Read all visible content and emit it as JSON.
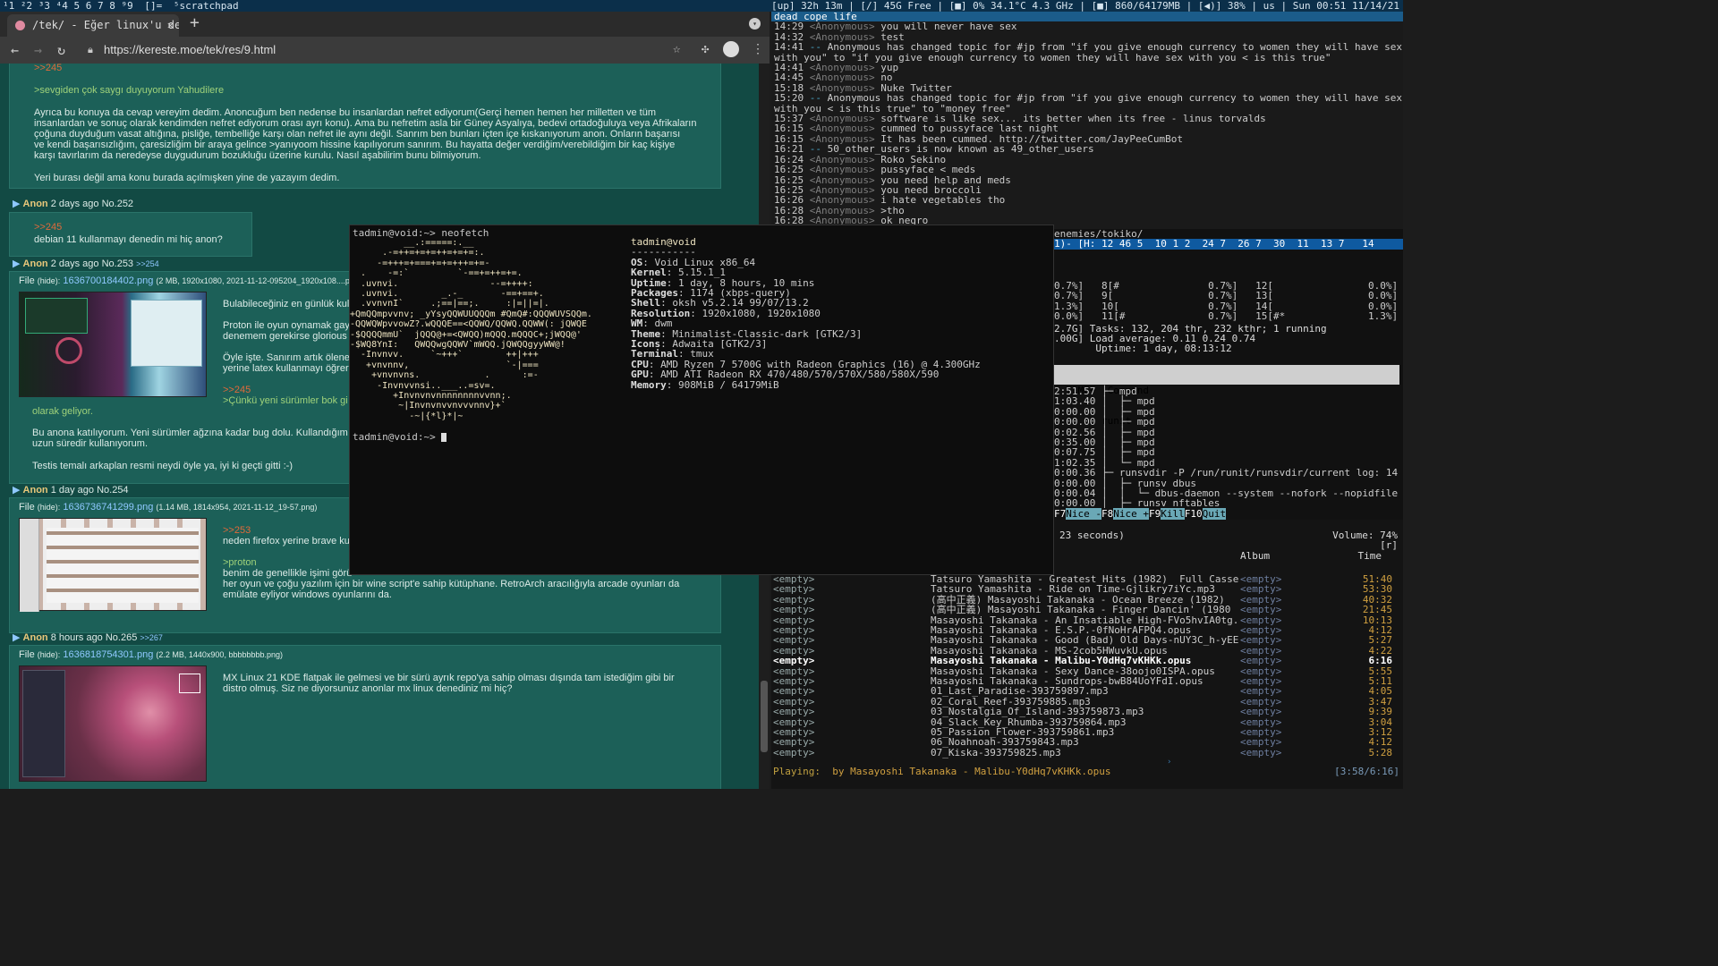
{
  "topbar": {
    "workspaces": "¹1 ²2 ³3 ⁴4 5 6 7 8 ⁹9",
    "layout": "[]=",
    "title": "⁵scratchpad",
    "status": "[up] 32h 13m | [/] 45G Free | [■] 0% 34.1°C 4.3 GHz | [■] 860/64179MB | [◀)] 38% | us | Sun 00:51 11/14/21"
  },
  "browser": {
    "tab_title": "/tek/ - Eğer linux'u denemek",
    "new_tab": "+",
    "url": "https://kereste.moe/tek/res/9.html"
  },
  "posts": {
    "p0": {
      "reply": ">>245",
      "quote": ">sevgiden çok saygı duyuyorum Yahudilere",
      "body1": "Ayrıca bu konuya da cevap vereyim dedim. Anoncuğum ben nedense bu insanlardan nefret ediyorum(Gerçi hemen hemen her milletten ve tüm",
      "body2": "insanlardan ve sonuç olarak kendimden nefret ediyorum orası ayrı konu). Ama bu nefretim asla bir Güney Asyalıya, bedevi ortadoğuluya veya Afrikaların",
      "body3": "çoğuna duyduğum vasat altığına, pisliğe, tembelliğe karşı olan nefret ile aynı değil. Sanrım ben bunları içten içe kıskanıyorum anon. Onların başarısı",
      "body4": "ve kendi başarısızlığım, çaresizliğim bir araya gelince >yanıyoom hissine kapılıyorum sanırım. Bu hayatta değer verdiğim/verebildiğim bir kaç kişiye",
      "body5": "karşı tavırlarım da neredeyse duygudurum bozukluğu üzerine kurulu. Nasıl aşabilirim bunu bilmiyorum.",
      "body6": "Yeri burası değil ama konu burada açılmışken yine de yazayım dedim."
    },
    "p252": {
      "name": "Anon",
      "meta": "2 days ago No.252",
      "reply": ">>245",
      "body": "debian 11 kullanmayı denedin mi hiç anon?"
    },
    "p253": {
      "name": "Anon",
      "meta": "2 days ago No.253",
      "backlink": ">>254",
      "file_label": "File",
      "hide": "(hide):",
      "file": "1636700184402.png",
      "file_meta": "(2 MB, 1920x1080, 2021-11-12-095204_1920x108....png)",
      "l1": "Bulabileceğiniz en günlük kul",
      "l2": "Proton ile oyun oynamak gay",
      "l3": "denemem gerekirse glorious",
      "l4": "Öyle işte. Sanırım artık ölene",
      "l5": "yerine latex kullanmayı öğrer",
      "reply": ">>245",
      "quote": ">Çünkü yeni sürümler bok gi",
      "l6": "olarak geliyor.",
      "l7": "Bu anona katılıyorum. Yeni sürümler ağzına kadar bug dolu. Kullandığım",
      "l8": "uzun süredir kullanıyorum.",
      "l9": "Testis temalı arkaplan resmi neydi öyle ya, iyi ki geçti gitti :-)"
    },
    "p254": {
      "name": "Anon",
      "meta": "1 day ago No.254",
      "file_label": "File",
      "hide": "(hide):",
      "file": "1636736741299.png",
      "file_meta": "(1.14 MB, 1814x954, 2021-11-12_19-57.png)",
      "reply": ">>253",
      "l1": "neden firefox yerine brave ku",
      "quote": ">proton",
      "l2": "benim de genellikle işimi görü",
      "l3": "her oyun ve çoğu yazılım için bir wine script'e sahip kütüphane. RetroArch aracılığıyla arcade oyunları da",
      "l4": "emülate eyliyor windows oyunlarını da."
    },
    "p265": {
      "name": "Anon",
      "meta": "8 hours ago No.265",
      "backlink": ">>267",
      "file_label": "File",
      "hide": "(hide):",
      "file": "1636818754301.png",
      "file_meta": "(2.2 MB, 1440x900, bbbbbbbb.png)",
      "l1": "MX Linux 21 KDE flatpak ile gelmesi ve bir sürü ayrık repo'ya sahip olması dışında tam istediğim gibi bir",
      "l2": "distro olmuş. Siz ne diyorsunuz anonlar mx linux denediniz mi hiç?"
    }
  },
  "terminal": {
    "prompt1": "tadmin@void:~> neofetch",
    "prompt2": "tadmin@void:~> ",
    "host": "tadmin@void",
    "sep": "-----------",
    "info": [
      [
        "OS",
        ": Void Linux x86_64"
      ],
      [
        "Kernel",
        ": 5.15.1_1"
      ],
      [
        "Uptime",
        ": 1 day, 8 hours, 10 mins"
      ],
      [
        "Packages",
        ": 1174 (xbps-query)"
      ],
      [
        "Shell",
        ": oksh v5.2.14 99/07/13.2"
      ],
      [
        "Resolution",
        ": 1920x1080, 1920x1080"
      ],
      [
        "WM",
        ": dwm"
      ],
      [
        "Theme",
        ": Minimalist-Classic-dark [GTK2/3]"
      ],
      [
        "Icons",
        ": Adwaita [GTK2/3]"
      ],
      [
        "Terminal",
        ": tmux"
      ],
      [
        "CPU",
        ": AMD Ryzen 7 5700G with Radeon Graphics (16) @ 4.300GHz"
      ],
      [
        "GPU",
        ": AMD ATI Radeon RX 470/480/570/570X/580/580X/590"
      ],
      [
        "Memory",
        ": 908MiB / 64179MiB"
      ]
    ],
    "art": [
      "          __.:=====:.__",
      "      .-=++=+=+=++=+=+=:.",
      "     -=+++=+===+=+=+++=+=-",
      "  .    -=:`         `-==+=++=+=.",
      "  .uvnvi.                 --=++++:",
      "  .uvnvi.        _.-_       -==+==+.",
      "  .vvnvnI`     .;==|==;.     :|=||=|.",
      "+QmQQmpvvnv; _yYsyQQWUUQQQm #QmQ#:QQQWUVSQQm.",
      "-QQWQWpvvowZ?.wQQQE==<QQWQ/QQWQ.QQWW(: jQWQE",
      "-$QQQQmmU`  jQQQ@+=<QWQQ)mQQQ.mQQQC+;jWQQ@'",
      "-$WQ8YnI:   QWQQwgQQWV`mWQQ.jQWQQgyyWW@!",
      "  -Invnvv.     `~+++`        ++|+++",
      "   +vnvnnv,                  `-|===",
      "    +vnvnvns.            .      :=-",
      "     -Invnvvnsi..___..=sv=.",
      "        +Invnvnvnnnnnnnnvvnn;.",
      "         ~|Invnvnvvnvvvnnv}+`",
      "           -~|{*l}*|~"
    ]
  },
  "irc": {
    "topic": "dead cope life",
    "lines": [
      [
        "14:29",
        "<Anonymous>",
        "you will never have sex"
      ],
      [
        "14:32",
        "<Anonymous>",
        "test"
      ],
      [
        "14:41",
        "--",
        "Anonymous has changed topic for #jp from \"if you give enough currency to women they will have sex"
      ],
      [
        "",
        "",
        "with you\" to \"if you give enough currency to women they will have sex with you < is this true\""
      ],
      [
        "14:41",
        "<Anonymous>",
        "yup"
      ],
      [
        "14:45",
        "<Anonymous>",
        "no"
      ],
      [
        "15:18",
        "<Anonymous>",
        "Nuke Twitter"
      ],
      [
        "15:20",
        "--",
        "Anonymous has changed topic for #jp from \"if you give enough currency to women they will have sex"
      ],
      [
        "",
        "",
        "with you < is this true\" to \"money free\""
      ],
      [
        "15:37",
        "<Anonymous>",
        "software is like sex... its better when its free - linus torvalds"
      ],
      [
        "16:15",
        "<Anonymous>",
        "cummed to pussyface last night"
      ],
      [
        "16:15",
        "<Anonymous>",
        "It has been cummed. http://twitter.com/JayPeeCumBot"
      ],
      [
        "16:21",
        "--",
        "50_other_users is now known as 49_other_users"
      ],
      [
        "16:24",
        "<Anonymous>",
        "Roko Sekino"
      ],
      [
        "16:25",
        "<Anonymous>",
        "pussyface < meds"
      ],
      [
        "16:25",
        "<Anonymous>",
        "you need help and meds"
      ],
      [
        "16:25",
        "<Anonymous>",
        "you need broccoli"
      ],
      [
        "16:26",
        "<Anonymous>",
        "i hate vegetables tho"
      ],
      [
        "16:28",
        "<Anonymous>",
        ">tho"
      ],
      [
        "16:28",
        "<Anonymous>",
        "ok negro"
      ]
    ],
    "path": "enemies/tokiko/"
  },
  "htop": {
    "cpu_bar": "1)- [H: 12 46 5  10 1 2  24 7  26 7  30  11  13 7   14",
    "rows": [
      "0.7%]   8[#               0.7%]   12[                0.0%]",
      "0.7%]   9[                0.7%]   13[                0.0%]",
      "1.3%]   10[               0.7%]   14[                0.0%]",
      "0.0%]   11[#              0.7%]   15[#*              1.3%]"
    ],
    "tasks": "2.7G] Tasks: 132, 204 thr, 232 kthr; 1 running",
    "load": ".00G] Load average: 0.11 0.24 0.74",
    "uptime": "       Uptime: 1 day, 08:13:12",
    "cols": "  TIME+  Command",
    "sel": "0:00.40 runit",
    "procs": [
      "2:51.57 ├─ mpd",
      "1:03.40 │  ├─ mpd",
      "0:00.00 │  ├─ mpd",
      "0:00.00 │  ├─ mpd",
      "0:02.56 │  ├─ mpd",
      "0:35.00 │  ├─ mpd",
      "0:07.75 │  ├─ mpd",
      "1:02.35 │  └─ mpd",
      "0:00.36 ├─ runsvdir -P /run/runit/runsvdir/current log: 14",
      "0:00.00 │  ├─ runsv dbus",
      "0:00.04 │  │  └─ dbus-daemon --system --nofork --nopidfile",
      "0:00.00 │  ├─ runsv nftables"
    ],
    "fkeys": [
      [
        "F7",
        "Nice -"
      ],
      [
        "F8",
        "Nice +"
      ],
      [
        "F9",
        "Kill"
      ],
      [
        "F10",
        "Quit"
      ]
    ]
  },
  "mpd": {
    "status": "23 seconds)",
    "volume": "Volume: 74%",
    "flags": "[r]",
    "col_album": "Album",
    "col_time": "Time",
    "rows": [
      [
        "<empty>",
        "Tatsuro Yamashita - Greatest Hits (1982)  Full Casse",
        "<empty>",
        "51:40"
      ],
      [
        "<empty>",
        "Tatsuro Yamashita - Ride on Time-Gjlikry7iYc.mp3",
        "<empty>",
        "53:30"
      ],
      [
        "<empty>",
        "(高中正義) Masayoshi Takanaka - Ocean Breeze (1982)",
        "<empty>",
        "40:32"
      ],
      [
        "<empty>",
        "(高中正義) Masayoshi Takanaka - Finger Dancin' (1980",
        "<empty>",
        "21:45"
      ],
      [
        "<empty>",
        "Masayoshi Takanaka - An Insatiable High-FVo5hvIA0tg.",
        "<empty>",
        "10:13"
      ],
      [
        "<empty>",
        "Masayoshi Takanaka - E.S.P.-0fNoHrAFPQ4.opus",
        "<empty>",
        "4:12"
      ],
      [
        "<empty>",
        "Masayoshi Takanaka - Good (Bad) Old Days-nUY3C_h-yEE",
        "<empty>",
        "5:27"
      ],
      [
        "<empty>",
        "Masayoshi Takanaka - MS-2cob5HWuvkU.opus",
        "<empty>",
        "4:22"
      ],
      [
        "<empty>",
        "Masayoshi Takanaka - Malibu-Y0dHq7vKHKk.opus",
        "<empty>",
        "6:16"
      ],
      [
        "<empty>",
        "Masayoshi Takanaka - Sexy Dance-38oojo0ISPA.opus",
        "<empty>",
        "5:55"
      ],
      [
        "<empty>",
        "Masayoshi Takanaka - Sundrops-bwB84UoYFdI.opus",
        "<empty>",
        "5:11"
      ],
      [
        "<empty>",
        "01_Last_Paradise-393759897.mp3",
        "<empty>",
        "4:05"
      ],
      [
        "<empty>",
        "02_Coral_Reef-393759885.mp3",
        "<empty>",
        "3:47"
      ],
      [
        "<empty>",
        "03_Nostalgia_Of_Island-393759873.mp3",
        "<empty>",
        "9:39"
      ],
      [
        "<empty>",
        "04_Slack_Key_Rhumba-393759864.mp3",
        "<empty>",
        "3:04"
      ],
      [
        "<empty>",
        "05_Passion_Flower-393759861.mp3",
        "<empty>",
        "3:12"
      ],
      [
        "<empty>",
        "06_Noahnoah-393759843.mp3",
        "<empty>",
        "4:12"
      ],
      [
        "<empty>",
        "07_Kiska-393759825.mp3",
        "<empty>",
        "5:28"
      ]
    ],
    "current_index": 8,
    "playing_label": "Playing:",
    "playing": "by Masayoshi Takanaka - Malibu-Y0dHq7vKHKk.opus",
    "elapsed": "[3:58/6:16]"
  }
}
